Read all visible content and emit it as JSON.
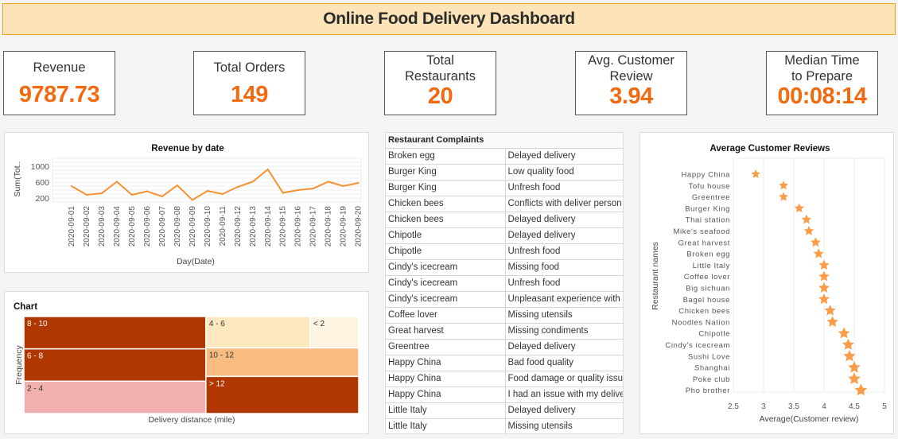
{
  "header": {
    "title": "Online Food Delivery Dashboard"
  },
  "kpis": [
    {
      "label": "Revenue",
      "value": "9787.73"
    },
    {
      "label": "Total Orders",
      "value": "149"
    },
    {
      "label": "Total Restaurants",
      "value": "20"
    },
    {
      "label": "Avg. Customer Review",
      "value": "3.94"
    },
    {
      "label": "Median Time to Prepare",
      "value": "00:08:14"
    }
  ],
  "kpi_labels_split": {
    "total_restaurants": [
      "Total",
      "Restaurants"
    ],
    "avg_review": [
      "Avg. Customer",
      "Review"
    ],
    "median_time": [
      "Median Time",
      "to Prepare"
    ]
  },
  "colors": {
    "accent": "#f26a10",
    "line": "#f7912e",
    "star": "#fa9d4a",
    "header_bg": "#fde4b8",
    "header_border": "#f5a21b"
  },
  "complaints": {
    "title": "Restaurant Complaints",
    "rows": [
      [
        "Broken egg",
        "Delayed delivery"
      ],
      [
        "Burger King",
        "Low quality food"
      ],
      [
        "Burger King",
        "Unfresh food"
      ],
      [
        "Chicken bees",
        "Conflicts with deliver person"
      ],
      [
        "Chicken bees",
        "Delayed delivery"
      ],
      [
        "Chipotle",
        "Delayed delivery"
      ],
      [
        "Chipotle",
        "Unfresh food"
      ],
      [
        "Cindy's icecream",
        "Missing food"
      ],
      [
        "Cindy's icecream",
        "Unfresh food"
      ],
      [
        "Cindy's icecream",
        "Unpleasant experience with deliver person"
      ],
      [
        "Coffee lover",
        "Missing utensils"
      ],
      [
        "Great harvest",
        "Missing condiments"
      ],
      [
        "Greentree",
        "Delayed delivery"
      ],
      [
        "Happy China",
        "Bad food quality"
      ],
      [
        "Happy China",
        "Food damage or quality issue"
      ],
      [
        "Happy China",
        "I had an issue with my delivery partner"
      ],
      [
        "Little Italy",
        "Delayed delivery"
      ],
      [
        "Little Italy",
        "Missing utensils"
      ]
    ]
  },
  "chart_data": [
    {
      "type": "line",
      "title": "Revenue by date",
      "xlabel": "Day(Date)",
      "ylabel": "Sum(Tot..",
      "x": [
        "2020-09-01",
        "2020-09-02",
        "2020-09-03",
        "2020-09-04",
        "2020-09-05",
        "2020-09-06",
        "2020-09-07",
        "2020-09-08",
        "2020-09-09",
        "2020-09-10",
        "2020-09-11",
        "2020-09-12",
        "2020-09-13",
        "2020-09-14",
        "2020-09-15",
        "2020-09-16",
        "2020-09-17",
        "2020-09-18",
        "2020-09-19",
        "2020-09-20"
      ],
      "values": [
        500,
        280,
        320,
        610,
        280,
        370,
        240,
        520,
        150,
        380,
        300,
        480,
        610,
        920,
        330,
        400,
        440,
        610,
        500,
        580
      ],
      "yticks": [
        200,
        600,
        1000
      ],
      "ylim": [
        100,
        1200
      ],
      "grid": true
    },
    {
      "type": "treemap",
      "title": "Chart",
      "xlabel": "Delivery distance (mile)",
      "ylabel": "Frequency",
      "categories": [
        "8 - 10",
        "6 - 8",
        "2 - 4",
        "4 - 6",
        "< 2",
        "10 - 12",
        "> 12"
      ],
      "values": [
        27,
        27,
        27,
        15,
        7,
        20,
        26
      ],
      "colors": [
        "#b03700",
        "#b03700",
        "#f1b0ae",
        "#fde8c0",
        "#fdf3e1",
        "#f8bc80",
        "#b03700"
      ],
      "label_colors": [
        "#ffffff",
        "#ffffff",
        "#333333",
        "#333333",
        "#333333",
        "#333333",
        "#ffffff"
      ]
    },
    {
      "type": "scatter",
      "title": "Average Customer Reviews",
      "xlabel": "Average(Customer review)",
      "ylabel": "Restaurant names",
      "xlim": [
        2.5,
        5
      ],
      "xticks": [
        2.5,
        3,
        3.5,
        4,
        4.5,
        5
      ],
      "categories": [
        "Happy China",
        "Tofu house",
        "Greentree",
        "Burger King",
        "Thai station",
        "Mike's seafood",
        "Great harvest",
        "Broken egg",
        "Little Italy",
        "Coffee lover",
        "Big sichuan",
        "Bagel house",
        "Chicken bees",
        "Noodles Nation",
        "Chipotle",
        "Cindy's icecream",
        "Sushi Love",
        "Shanghai",
        "Poke club",
        "Pho brother"
      ],
      "values": [
        2.87,
        3.33,
        3.33,
        3.59,
        3.71,
        3.75,
        3.86,
        3.91,
        4.0,
        4.0,
        4.0,
        4.0,
        4.1,
        4.14,
        4.33,
        4.4,
        4.42,
        4.5,
        4.5,
        4.61
      ],
      "marker": "star",
      "grid": true
    }
  ]
}
